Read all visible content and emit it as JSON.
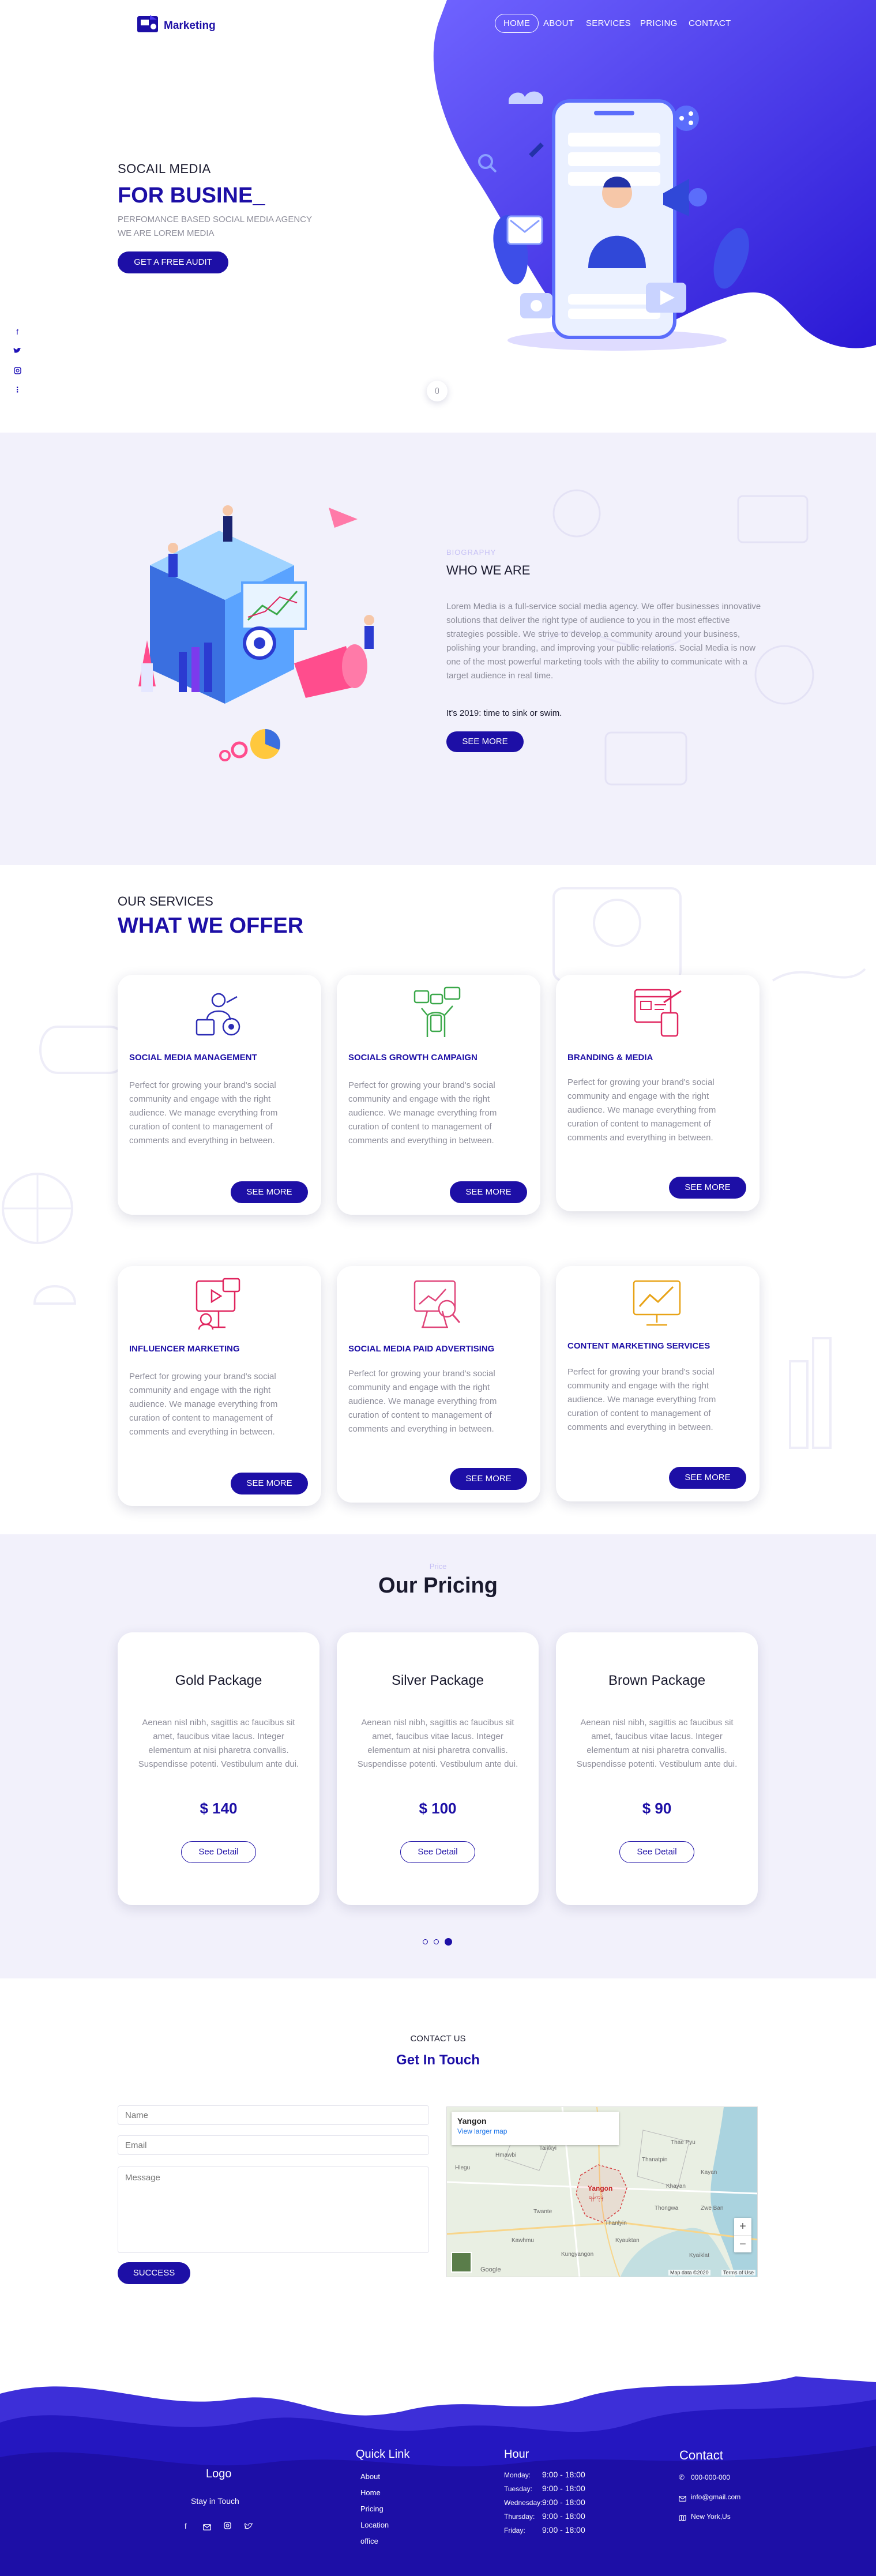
{
  "header": {
    "logo_text": "Marketing",
    "nav": [
      {
        "label": "HOME",
        "active": true
      },
      {
        "label": "ABOUT",
        "active": false
      },
      {
        "label": "SERVICES",
        "active": false
      },
      {
        "label": "PRICING",
        "active": false
      },
      {
        "label": "CONTACT",
        "active": false
      }
    ]
  },
  "hero": {
    "kicker": "SOCAIL MEDIA",
    "headline": "FOR BUSINE_",
    "subline1": "PERFOMANCE BASED SOCIAL MEDIA AGENCY",
    "subline2": "WE ARE LOREM MEDIA",
    "cta_label": "GET A FREE AUDIT",
    "side_social_icons": [
      "facebook-icon",
      "twitter-icon",
      "instagram-icon",
      "more-icon"
    ]
  },
  "about": {
    "kicker": "BIOGRAPHY",
    "title": "WHO WE ARE",
    "body": "Lorem Media is a full-service social media agency. We offer businesses innovative solutions that deliver the right type of audience to you in the most effective strategies possible. We strive to develop a community around your business, polishing your branding, and improving your public relations. Social Media is now one of the most powerful marketing tools with the ability to communicate with a target audience in real time.",
    "tagline": "It's 2019: time to sink or swim.",
    "button_label": "SEE MORE"
  },
  "services": {
    "kicker": "OUR SERVICES",
    "title": "WHAT WE OFFER",
    "cards": [
      {
        "title": "SOCIAL MEDIA MANAGEMENT",
        "icon": "social-media-management-icon",
        "color": "#2d2db5",
        "text": "Perfect for growing your brand's social community and engage with the right audience. We manage everything from curation of content to management of comments and everything in between.",
        "button": "SEE MORE"
      },
      {
        "title": "SOCIALS GROWTH CAMPAIGN",
        "icon": "growth-campaign-icon",
        "color": "#3ba84a",
        "text": "Perfect for growing your brand's social community and engage with the right audience. We manage everything from curation of content to management of comments and everything in between.",
        "button": "SEE MORE"
      },
      {
        "title": "BRANDING & MEDIA",
        "icon": "branding-media-icon",
        "color": "#e0245e",
        "text": "Perfect for growing your brand's social community and engage with the right audience. We manage everything from curation of content to management of comments and everything in between.",
        "button": "SEE MORE"
      },
      {
        "title": "INFLUENCER MARKETING",
        "icon": "influencer-marketing-icon",
        "color": "#e0245e",
        "text": "Perfect for growing your brand's social community and engage with the right audience. We manage everything from curation of content to management of comments and everything in between.",
        "button": "SEE MORE"
      },
      {
        "title": "SOCIAL MEDIA PAID ADVERTISING",
        "icon": "paid-advertising-icon",
        "color": "#e0457a",
        "text": "Perfect for growing your brand's social community and engage with the right audience. We manage everything from curation of content to management of comments and everything in between.",
        "button": "SEE MORE"
      },
      {
        "title": "CONTENT MARKETING SERVICES",
        "icon": "content-marketing-icon",
        "color": "#e8a317",
        "text": "Perfect for growing your brand's social community and engage with the right audience. We manage everything from curation of content to management of comments and everything in between.",
        "button": "SEE MORE"
      }
    ]
  },
  "pricing": {
    "kicker": "Price",
    "title": "Our Pricing",
    "plans": [
      {
        "name": "Gold Package",
        "text": "Aenean nisl nibh, sagittis ac faucibus sit amet, faucibus vitae lacus. Integer elementum at nisi pharetra convallis. Suspendisse potenti. Vestibulum ante dui.",
        "price": "$ 140",
        "button": "See Detail"
      },
      {
        "name": "Silver Package",
        "text": "Aenean nisl nibh, sagittis ac faucibus sit amet, faucibus vitae lacus. Integer elementum at nisi pharetra convallis. Suspendisse potenti. Vestibulum ante dui.",
        "price": "$ 100",
        "button": "See Detail"
      },
      {
        "name": "Brown Package",
        "text": "Aenean nisl nibh, sagittis ac faucibus sit amet, faucibus vitae lacus. Integer elementum at nisi pharetra convallis. Suspendisse potenti. Vestibulum ante dui.",
        "price": "$ 90",
        "button": "See Detail"
      }
    ],
    "carousel_active_dot": 3
  },
  "contact": {
    "kicker": "CONTACT US",
    "title": "Get In Touch",
    "name_placeholder": "Name",
    "email_placeholder": "Email",
    "message_placeholder": "Message",
    "submit_label": "SUCCESS",
    "map": {
      "place_name": "Yangon",
      "larger_map_link": "View larger map",
      "city_label": "Yangon",
      "city_sublabel": "ရန်ကုန်",
      "zoom_in": "+",
      "zoom_out": "−",
      "attribution": "Map data ©2020",
      "terms": "Terms of Use",
      "provider": "Google",
      "place_labels": [
        "Hlegu",
        "Hmawbi",
        "Taikkyi",
        "Thanatpin",
        "Thae Pyu",
        "Kayan",
        "Khayan",
        "Thongwa",
        "Thanlyin",
        "Kyauktan",
        "Twante",
        "Kawhmu",
        "Kungyangon",
        "Kyaiklat",
        "Zwe Ban"
      ]
    }
  },
  "footer": {
    "logo": "Logo",
    "tagline": "Stay in Touch",
    "social_icons": [
      "facebook-icon",
      "mail-icon",
      "instagram-icon",
      "twitter-icon"
    ],
    "quick_link_title": "Quick Link",
    "quick_links": [
      "About",
      "Home",
      "Pricing",
      "Location",
      "office"
    ],
    "hour_title": "Hour",
    "hours": [
      {
        "day": "Monday:",
        "time": "9:00 - 18:00"
      },
      {
        "day": "Tuesday:",
        "time": "9:00 - 18:00"
      },
      {
        "day": "Wednesday:",
        "time": "9:00 - 18:00"
      },
      {
        "day": "Thursday:",
        "time": "9:00 - 18:00"
      },
      {
        "day": "Friday:",
        "time": "9:00 - 18:00"
      }
    ],
    "contact_title": "Contact",
    "phone": "000-000-000",
    "email": "info@gmail.com",
    "address": "New York,Us"
  },
  "colors": {
    "brand": "#1d0fa6",
    "accent": "#4a39f0",
    "soft_bg": "#f2f1fb"
  }
}
